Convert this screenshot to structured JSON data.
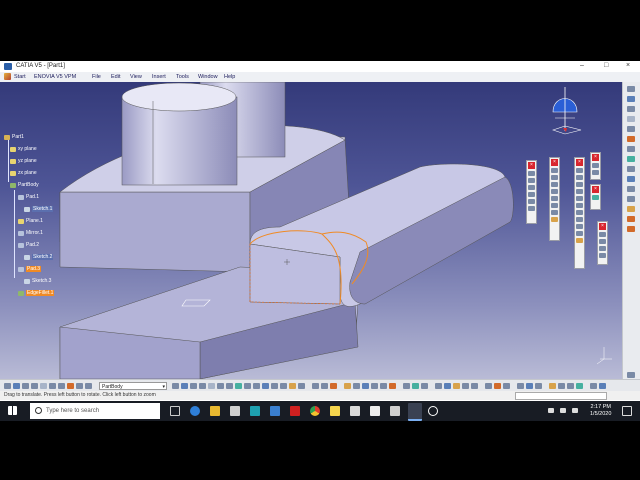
{
  "window": {
    "title": "CATIA V5 - [Part1]",
    "controls": [
      "–",
      "□",
      "×"
    ]
  },
  "menu": {
    "items": [
      "Start",
      "ENOVIA V5 VPM",
      "File",
      "Edit",
      "View",
      "Insert",
      "Tools",
      "Window",
      "Help"
    ]
  },
  "tree": {
    "root": "Part1",
    "planes": [
      "xy plane",
      "yz plane",
      "zx plane"
    ],
    "body": "PartBody",
    "pad1": "Pad.1",
    "sketch1": "Sketch.1",
    "plane1": "Plane.1",
    "mirror1": "Mirror.1",
    "pad2": "Pad.2",
    "sketch2": "Sketch.2",
    "pad3": "Pad.3",
    "sketch3": "Sketch.3",
    "edgefillet": "EdgeFillet.1"
  },
  "toolbar": {
    "body_select": "PartBody"
  },
  "status": {
    "message": "Drag to translate. Press left button to rotate. Click left button to zoom"
  },
  "taskbar": {
    "search_placeholder": "Type here to search",
    "time": "2:17 PM",
    "date": "1/5/2020"
  },
  "colors": {
    "accent": "#f08a24",
    "viewport_top": "#343a7a",
    "viewport_bottom": "#b9bbd6",
    "close_red": "#d8262e"
  },
  "icons": [
    "windows-icon",
    "task-view-icon",
    "edge-icon",
    "file-explorer-icon",
    "store-icon",
    "l-app-icon",
    "mail-icon",
    "mcafee-icon",
    "chrome-icon",
    "sticky-notes-icon",
    "calculator-icon",
    "photos-icon",
    "app-icon",
    "catia-icon",
    "obs-icon"
  ]
}
